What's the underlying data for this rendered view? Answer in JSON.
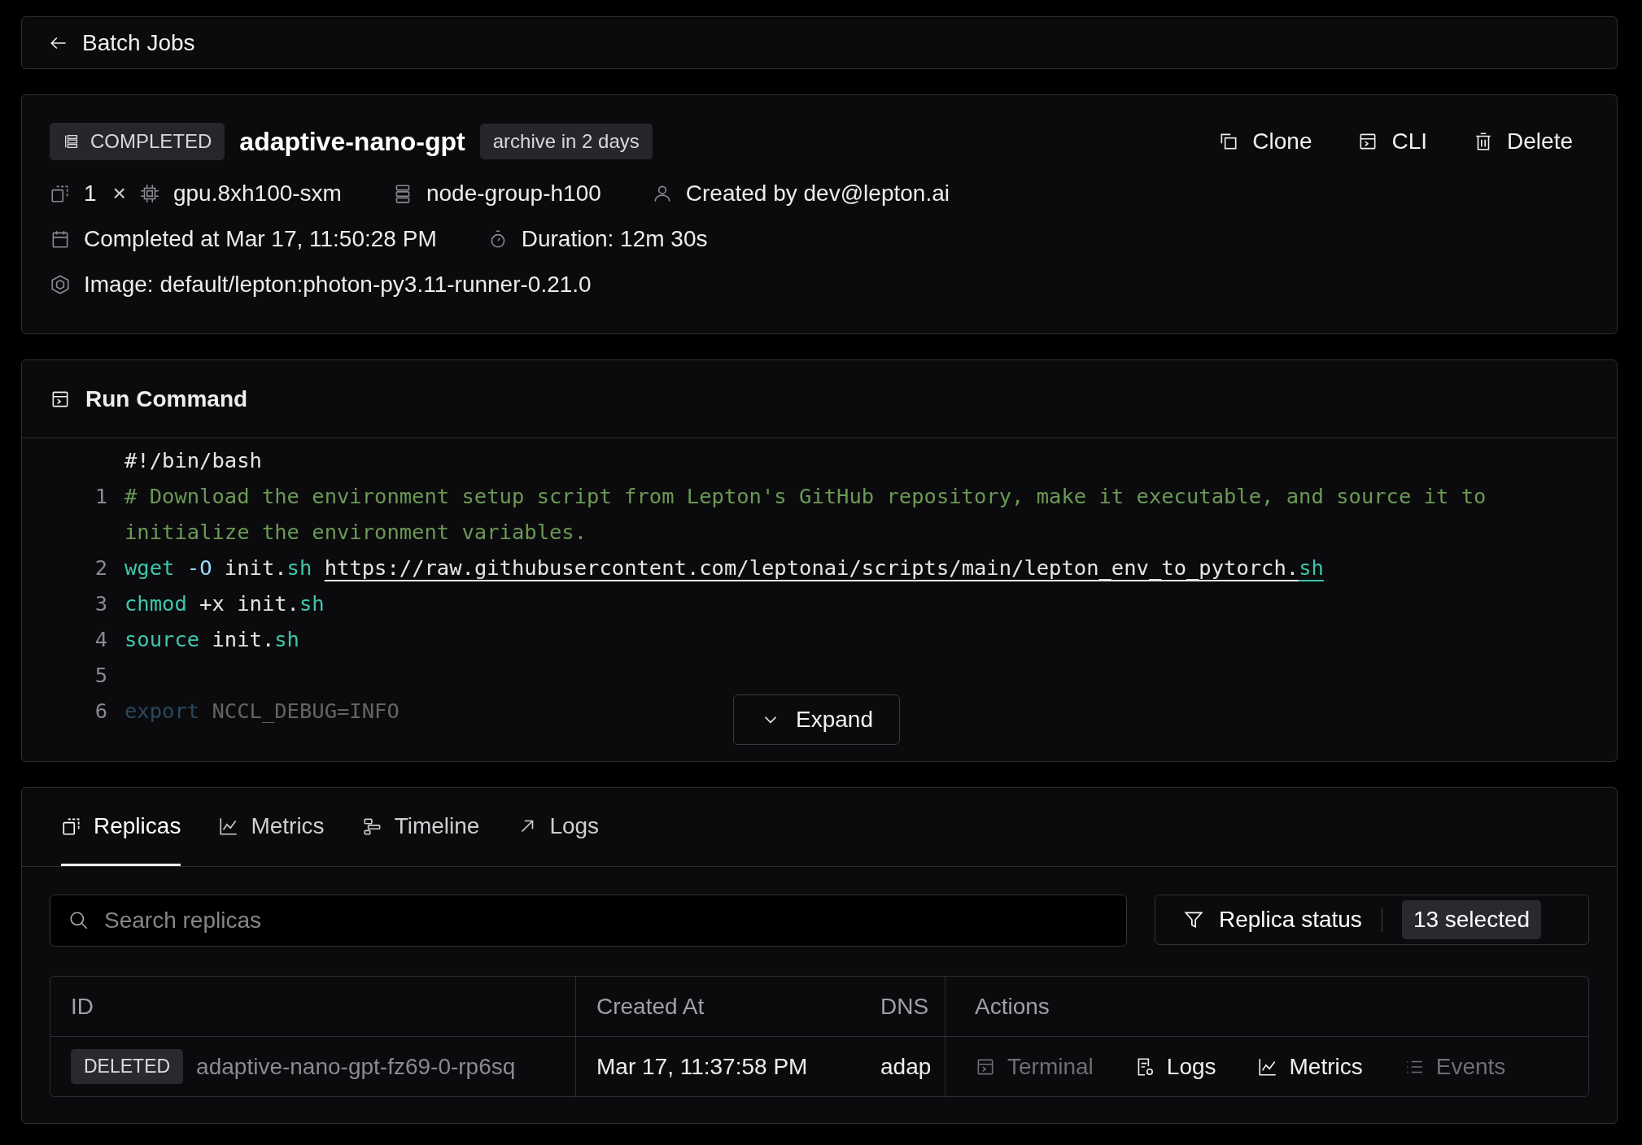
{
  "back_link": {
    "label": "Batch Jobs"
  },
  "job": {
    "status": "COMPLETED",
    "name": "adaptive-nano-gpt",
    "archive_tag": "archive in 2 days",
    "actions": [
      {
        "kind": "clone",
        "label": "Clone"
      },
      {
        "kind": "cli",
        "label": "CLI"
      },
      {
        "kind": "delete",
        "label": "Delete"
      }
    ],
    "meta_rows": [
      [
        {
          "kind": "replicas",
          "text": "1"
        },
        {
          "kind": "times",
          "text": "×"
        },
        {
          "kind": "gpu",
          "text": "gpu.8xh100-sxm"
        },
        {
          "kind": "node-group",
          "text": "node-group-h100"
        },
        {
          "kind": "user",
          "text": "Created by dev@lepton.ai"
        }
      ],
      [
        {
          "kind": "calendar",
          "text": "Completed at Mar 17, 11:50:28 PM"
        },
        {
          "kind": "timer",
          "text": "Duration: 12m 30s"
        }
      ],
      [
        {
          "kind": "image",
          "text": "Image: default/lepton:photon-py3.11-runner-0.21.0"
        }
      ]
    ]
  },
  "run_command": {
    "title": "Run Command",
    "expand_label": "Expand",
    "lines": [
      {
        "faded": false,
        "tokens": [
          {
            "kind": "plain",
            "text": "#!/bin/bash"
          }
        ]
      },
      {
        "number": "1",
        "faded": false,
        "tokens": [
          {
            "kind": "comment",
            "text": "# Download the environment setup script from Lepton's GitHub repository, make it executable, and source it to initialize the environment variables."
          }
        ]
      },
      {
        "number": "2",
        "faded": false,
        "tokens": [
          {
            "kind": "command",
            "text": "wget"
          },
          {
            "kind": "flag",
            "text": " -O"
          },
          {
            "kind": "plain",
            "text": " init."
          },
          {
            "kind": "ext",
            "text": "sh "
          },
          {
            "kind": "link",
            "text": "https://raw.githubusercontent.com/leptonai/scripts/main/lepton_env_to_pytorch."
          },
          {
            "kind": "link-ext",
            "text": "sh"
          }
        ]
      },
      {
        "number": "3",
        "faded": false,
        "tokens": [
          {
            "kind": "command",
            "text": "chmod"
          },
          {
            "kind": "plain",
            "text": " +x init."
          },
          {
            "kind": "ext",
            "text": "sh"
          }
        ]
      },
      {
        "number": "4",
        "faded": false,
        "tokens": [
          {
            "kind": "command",
            "text": "source"
          },
          {
            "kind": "plain",
            "text": " init."
          },
          {
            "kind": "ext",
            "text": "sh"
          }
        ]
      },
      {
        "number": "5"
      },
      {
        "number": "6",
        "faded": true,
        "tokens": [
          {
            "kind": "keyword",
            "text": "export"
          },
          {
            "kind": "plain",
            "text": " NCCL_DEBUG=INFO"
          }
        ]
      }
    ]
  },
  "tabs": [
    {
      "kind": "replicas",
      "label": "Replicas",
      "selected": true
    },
    {
      "kind": "metrics",
      "label": "Metrics",
      "selected": false
    },
    {
      "kind": "timeline",
      "label": "Timeline",
      "selected": false
    },
    {
      "kind": "logs",
      "label": "Logs",
      "selected": false
    }
  ],
  "search": {
    "placeholder": "Search replicas"
  },
  "status_filter": {
    "label": "Replica status",
    "badge": "13 selected"
  },
  "table": {
    "columns": [
      "ID",
      "Created At",
      "DNS",
      "Actions"
    ],
    "rows": [
      {
        "status": "DELETED",
        "id": "adaptive-nano-gpt-fz69-0-rp6sq",
        "created_at": "Mar 17, 11:37:58 PM",
        "dns": "adap",
        "actions": [
          {
            "kind": "terminal",
            "label": "Terminal",
            "disabled": true
          },
          {
            "kind": "logs",
            "label": "Logs",
            "disabled": false
          },
          {
            "kind": "metrics",
            "label": "Metrics",
            "disabled": false
          },
          {
            "kind": "events",
            "label": "Events",
            "disabled": true
          }
        ]
      }
    ]
  }
}
